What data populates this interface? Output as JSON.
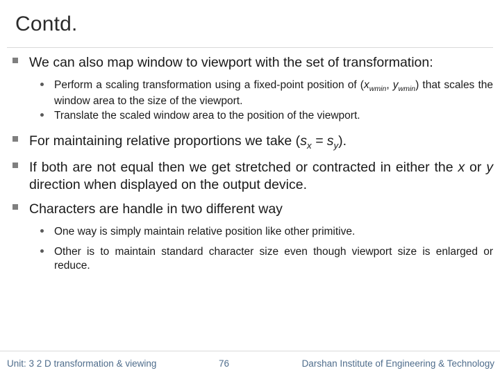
{
  "slide": {
    "title": "Contd.",
    "bullets": [
      {
        "level": 1,
        "text_pre": "We can also map window to viewport with the set of transformation:"
      },
      {
        "level": 2,
        "text_pre": "Perform a scaling transformation using a fixed-point position of (",
        "math1_var": "x",
        "math1_sub": "wmin",
        "math_comma": ", ",
        "math2_var": "y",
        "math2_sub": "wmin",
        "text_post": ") that scales the window area to the size of the viewport."
      },
      {
        "level": 2,
        "text_pre": "Translate the scaled window area to the position of the viewport."
      },
      {
        "level": 1,
        "text_pre": "For maintaining relative proportions we take (",
        "math1_var": "s",
        "math1_sub": "x",
        "math_eq": " = ",
        "math2_var": "s",
        "math2_sub": "y",
        "text_post": ")."
      },
      {
        "level": 1,
        "text_pre": "If both are not equal then we get stretched or contracted in either the ",
        "math1_var": "x",
        "math_or": " or ",
        "math2_var": "y",
        "text_post": " direction when displayed on the output device."
      },
      {
        "level": 1,
        "text_pre": "Characters are handle in two different way"
      },
      {
        "level": 2,
        "text_pre": "One way is simply maintain relative position like other primitive."
      },
      {
        "level": 2,
        "text_pre": "Other is to maintain standard character size even though viewport size is enlarged or reduce."
      }
    ]
  },
  "footer": {
    "left": "Unit: 3 2 D transformation & viewing",
    "page_number": "76",
    "right": "Darshan Institute of Engineering & Technology"
  },
  "colors": {
    "title": "#2b2b2b",
    "body_text": "#1a1a1a",
    "bullet_square": "#7f7f7f",
    "footer_text": "#4f6d8c",
    "rule": "#d9d9d9"
  }
}
